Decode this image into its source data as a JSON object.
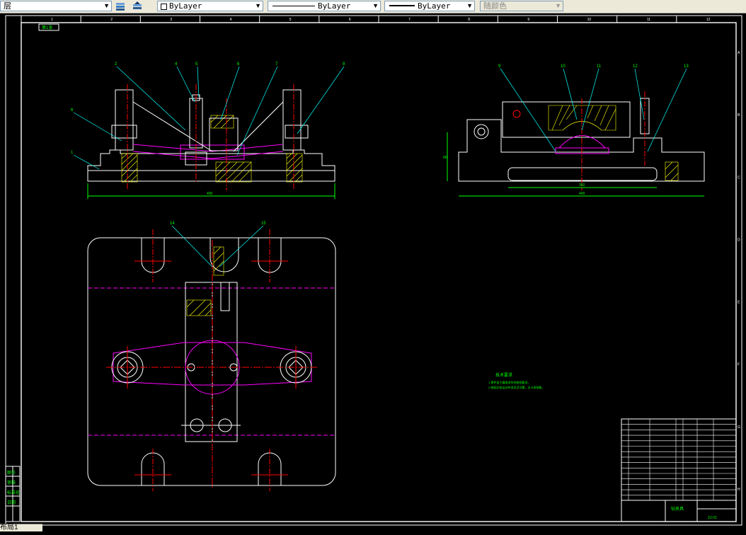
{
  "toolbar": {
    "layer_label": "层",
    "color_value": "ByLayer",
    "linetype_value": "ByLayer",
    "lineweight_value": "ByLayer",
    "plotstyle_value": "随颜色"
  },
  "drawing": {
    "top_left_tag": "第1张",
    "column_numbers": [
      "1",
      "2",
      "3",
      "4",
      "5",
      "6",
      "7",
      "8",
      "9",
      "10",
      "11",
      "12"
    ],
    "row_letters": [
      "A",
      "B",
      "C",
      "D",
      "E",
      "F",
      "G",
      "H"
    ],
    "front_view_balloons": [
      "2",
      "4",
      "5",
      "6",
      "7",
      "8"
    ],
    "front_view_left_balloons": [
      "6",
      "1"
    ],
    "side_view_balloons": [
      "9",
      "10",
      "11",
      "12",
      "13"
    ],
    "plan_view_balloons": [
      "14",
      "15"
    ],
    "front_width_dim": "400",
    "side_width_dim": "400",
    "side_inner_dim": "360",
    "side_height_dim": "80",
    "tech_title": "技术要求",
    "tech_line1": "1.零件加工精度须符合图纸要求。",
    "tech_line2": "2.装配后各运动件须灵活可靠，无卡滞现象。",
    "title_block_name": "钻夹具",
    "title_block_code": "ZJ-01",
    "left_strip_labels": [
      "图号",
      "审核",
      "标准化",
      "日期"
    ]
  },
  "status": {
    "layout_tab": "布局1"
  },
  "colors": {
    "background": "#000000",
    "frame": "#ffffff",
    "object": "#ffffff",
    "centerline": "#ff0000",
    "hidden": "#ff00ff",
    "leader": "#00ffff",
    "dimension": "#00ff00",
    "hatch": "#ffff00"
  }
}
